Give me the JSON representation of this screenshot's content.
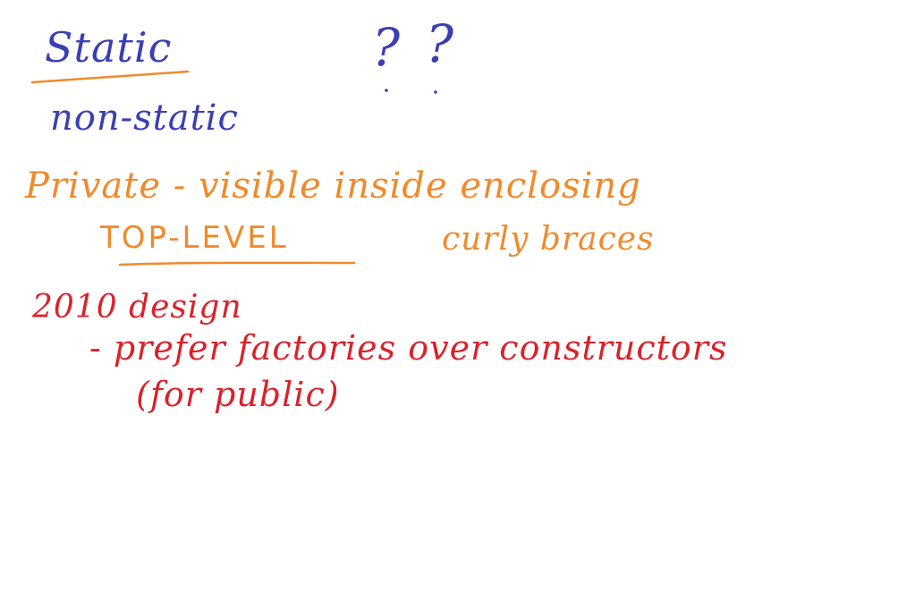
{
  "canvas": {
    "background": "#ffffff"
  },
  "notes": {
    "static": "Static",
    "question_1": "?",
    "question_2": "?",
    "non_static": "non-static",
    "private_line": "Private - visible inside enclosing",
    "top_level": "TOP-LEVEL",
    "curly_braces": "curly braces",
    "design_2010": "2010 design",
    "prefer_line": "- prefer factories over constructors",
    "for_public": "(for public)"
  },
  "colors": {
    "blue_ink": "#3a3fb3",
    "orange_ink": "#f08a2b",
    "red_ink": "#d9222b"
  }
}
